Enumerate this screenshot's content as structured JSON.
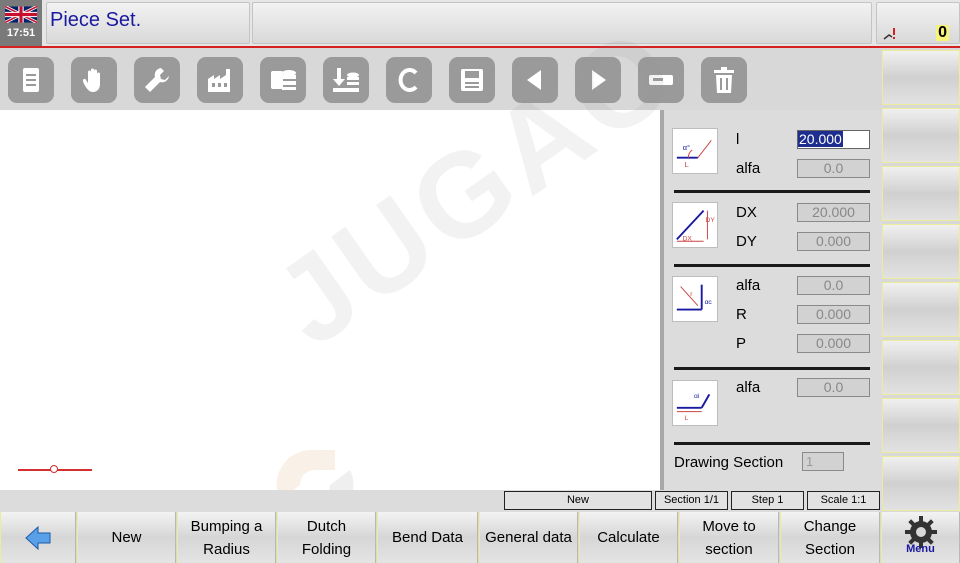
{
  "header": {
    "clock": "17:51",
    "title": "Piece Set.",
    "alarm_count": "0",
    "language_icon": "uk-flag-icon"
  },
  "toolbar": {
    "icons": [
      "document-icon",
      "hand-icon",
      "wrench-icon",
      "factory-icon",
      "database-icon",
      "download-database-icon",
      "c-letter-icon",
      "save-icon",
      "arrow-left-icon",
      "arrow-right-icon",
      "minus-icon",
      "trash-icon"
    ]
  },
  "watermark": "JUGAO",
  "panel": {
    "section1": {
      "l_label": "l",
      "l_value": "20.000",
      "alfa_label": "alfa",
      "alfa_value": "0.0"
    },
    "section2": {
      "dx_label": "DX",
      "dx_value": "20.000",
      "dy_label": "DY",
      "dy_value": "0.000"
    },
    "section3": {
      "alfa_label": "alfa",
      "alfa_value": "0.0",
      "r_label": "R",
      "r_value": "0.000",
      "p_label": "P",
      "p_value": "0.000"
    },
    "section4": {
      "alfa_label": "alfa",
      "alfa_value": "0.0"
    },
    "drawing_section_label": "Drawing Section",
    "drawing_section_value": "1",
    "pic_labels": {
      "pic1_angle": "α°",
      "pic1_len": "L",
      "pic2_dx": "DX",
      "pic2_dy": "DY",
      "pic3_angle": "αc",
      "pic3_r": "r",
      "pic4_angle": "αi",
      "pic4_len": "L"
    }
  },
  "statusbar": {
    "mode": "New",
    "section": "Section 1/1",
    "step": "Step 1",
    "scale": "Scale 1:1"
  },
  "bottom": {
    "new": "New",
    "bumping_line1": "Bumping a",
    "bumping_line2": "Radius",
    "dutch_line1": "Dutch",
    "dutch_line2": "Folding",
    "bend_data": "Bend Data",
    "general_data": "General data",
    "calculate": "Calculate",
    "move_line1": "Move to",
    "move_line2": "section",
    "change_line1": "Change",
    "change_line2": "Section",
    "menu": "Menu"
  },
  "colors": {
    "accent_blue": "#1a1aa0",
    "header_red": "#d42020",
    "selection": "#1d2e8f",
    "tool_gray": "#9a9a9a"
  }
}
